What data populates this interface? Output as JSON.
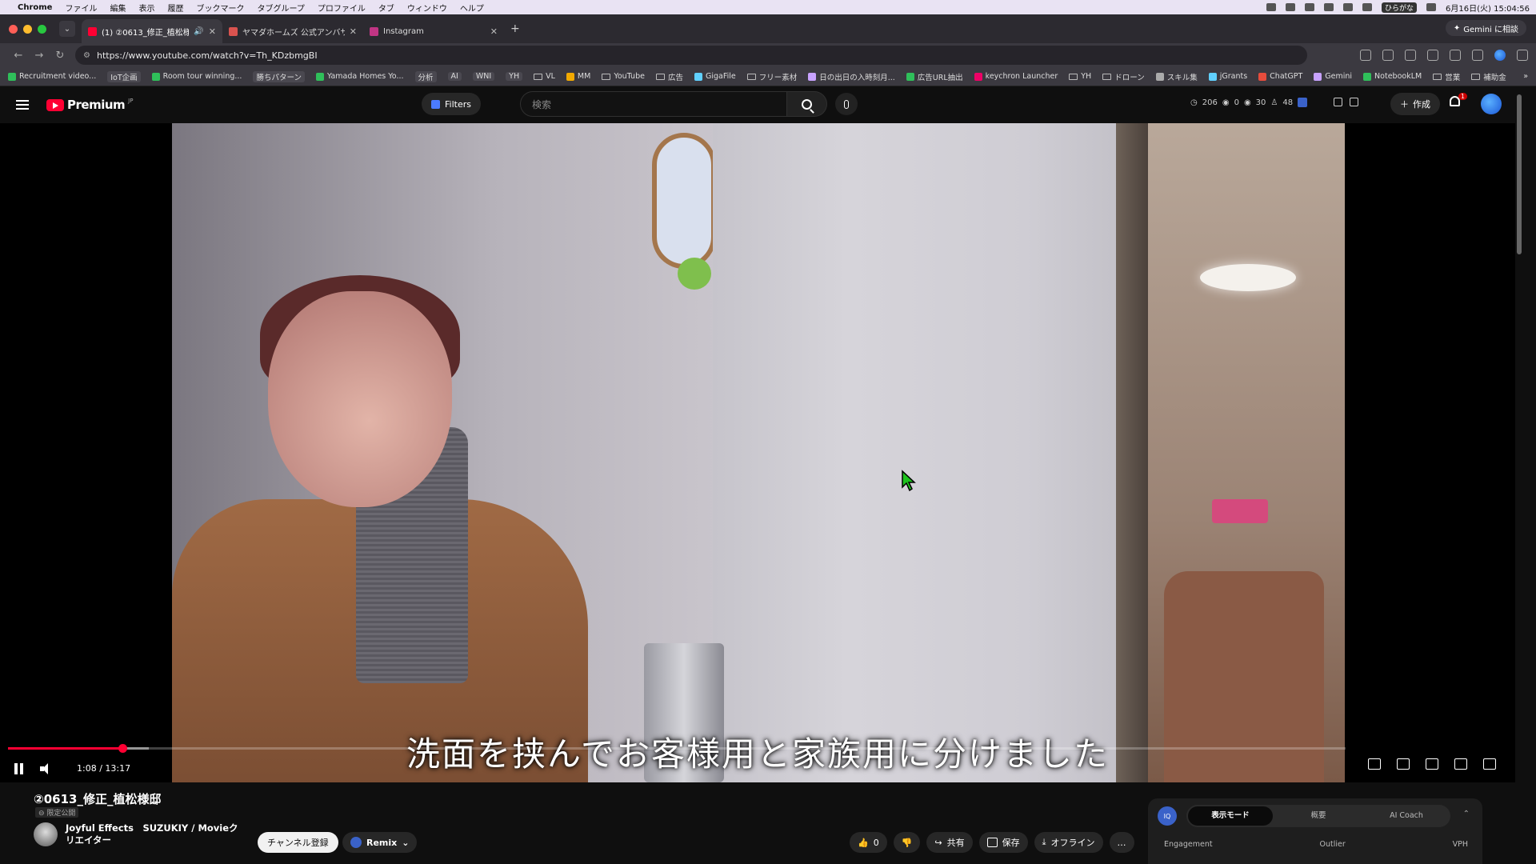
{
  "macos_menubar": {
    "app": "Chrome",
    "items": [
      "ファイル",
      "編集",
      "表示",
      "履歴",
      "ブックマーク",
      "タブグループ",
      "プロファイル",
      "タブ",
      "ウィンドウ",
      "ヘルプ"
    ],
    "ime": "ひらがな",
    "clock": "6月16日(火) 15:04:56"
  },
  "browser": {
    "tabs": [
      {
        "label": "(1) ②0613_修正_植松様邸",
        "color": "#ff0033",
        "active": true
      },
      {
        "label": "ヤマダホームズ 公式アンバサダー",
        "color": "#d9534f",
        "active": false
      },
      {
        "label": "Instagram",
        "color": "#c13584",
        "active": false
      }
    ],
    "new_tab": "+",
    "gemini_button": "Gemini に相談",
    "url": "https://www.youtube.com/watch?v=Th_KDzbmgBI",
    "bookmarks": [
      {
        "label": "Recruitment video...",
        "kind": "check"
      },
      {
        "label": "IoT企画",
        "kind": "chip"
      },
      {
        "label": "Room tour winning...",
        "kind": "check"
      },
      {
        "label": "勝ちパターン",
        "kind": "chip"
      },
      {
        "label": "Yamada Homes Yo...",
        "kind": "check"
      },
      {
        "label": "分析",
        "kind": "chip"
      },
      {
        "label": "AI",
        "kind": "chip"
      },
      {
        "label": "WNI",
        "kind": "chip"
      },
      {
        "label": "YH",
        "kind": "chip"
      },
      {
        "label": "VL",
        "kind": "folder"
      },
      {
        "label": "MM",
        "kind": "icon"
      },
      {
        "label": "YouTube",
        "kind": "folder"
      },
      {
        "label": "広告",
        "kind": "folder"
      },
      {
        "label": "GigaFile",
        "kind": "icon"
      },
      {
        "label": "フリー素材",
        "kind": "folder"
      },
      {
        "label": "日の出日の入時刻月...",
        "kind": "icon"
      },
      {
        "label": "広告URL抽出",
        "kind": "icon"
      },
      {
        "label": "keychron Launcher",
        "kind": "icon"
      },
      {
        "label": "YH",
        "kind": "folder"
      },
      {
        "label": "ドローン",
        "kind": "folder"
      },
      {
        "label": "スキル集",
        "kind": "icon"
      },
      {
        "label": "jGrants",
        "kind": "icon"
      },
      {
        "label": "ChatGPT",
        "kind": "icon"
      },
      {
        "label": "Gemini",
        "kind": "icon"
      },
      {
        "label": "NotebookLM",
        "kind": "icon"
      },
      {
        "label": "営業",
        "kind": "folder"
      },
      {
        "label": "補助金",
        "kind": "folder"
      }
    ],
    "bookmarks_more": "»"
  },
  "youtube_header": {
    "brand": "Premium",
    "region": "JP",
    "filters_label": "Filters",
    "search_placeholder": "検索",
    "stats": {
      "views": "206",
      "a": "0",
      "b": "30",
      "c": "48"
    },
    "create_label": "作成",
    "notification_count": "1"
  },
  "player": {
    "subtitle": "洗面を挟んでお客様用と家族用に分けました",
    "current_time": "1:08",
    "duration": "13:17",
    "time_display": "1:08 / 13:17",
    "progress_fraction": 0.0853,
    "buffered_fraction": 0.105
  },
  "video_info": {
    "title": "②0613_修正_植松様邸",
    "privacy": "限定公開",
    "channel": "Joyful Effects　SUZUKIY / Movieクリエイター",
    "subscribe_label": "チャンネル登録",
    "remix_label": "Remix",
    "like_count": "0",
    "share_label": "共有",
    "save_label": "保存",
    "offline_label": "オフライン",
    "more_label": "…"
  },
  "iq_panel": {
    "logo": "IQ",
    "tabs": [
      "表示モード",
      "概要",
      "AI Coach"
    ],
    "active_tab": 0,
    "columns": [
      "Engagement",
      "Outlier",
      "VPH"
    ]
  }
}
